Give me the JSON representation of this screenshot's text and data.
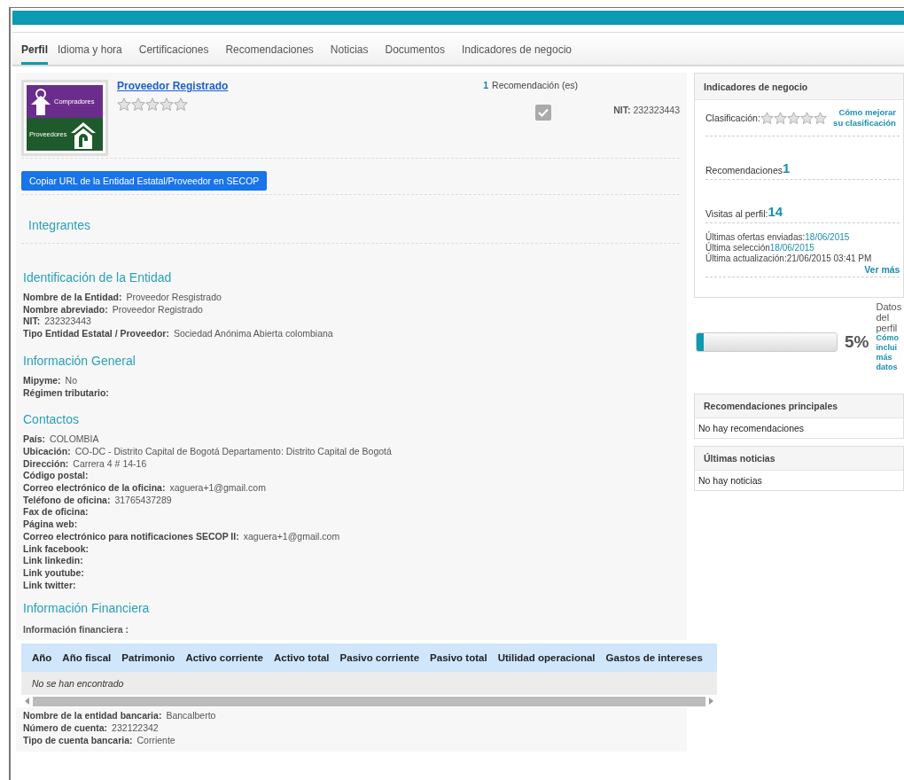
{
  "tabs": [
    {
      "label": "Perfil",
      "selected": true
    },
    {
      "label": "Idioma y hora",
      "selected": false
    },
    {
      "label": "Certificaciones",
      "selected": false
    },
    {
      "label": "Recomendaciones",
      "selected": false
    },
    {
      "label": "Noticias",
      "selected": false
    },
    {
      "label": "Documentos",
      "selected": false
    },
    {
      "label": "Indicadores de negocio",
      "selected": false
    }
  ],
  "profile": {
    "logo": {
      "top_text": "Compradores",
      "bottom_text": "Proveedores"
    },
    "name": "Proveedor Registrado",
    "stars": 0,
    "recommendations_count": "1",
    "recommendations_label": "Recomendación (es)",
    "verified": true,
    "nit_label": "NIT:",
    "nit": "232323443",
    "copy_button": "Copiar URL de la Entidad Estatal/Proveedor en SECOP",
    "members_title": "Integrantes"
  },
  "sections": [
    {
      "title": "Identificación de la Entidad",
      "fields": [
        {
          "label": "Nombre de la Entidad:",
          "value": "Proveedor Resgistrado"
        },
        {
          "label": "Nombre abreviado:",
          "value": "Proveedor Registrado"
        },
        {
          "label": "NIT:",
          "value": "232323443"
        },
        {
          "label": "Tipo Entidad Estatal / Proveedor:",
          "value": "Sociedad Anónima Abierta colombiana"
        }
      ]
    },
    {
      "title": "Información General",
      "fields": [
        {
          "label": "Mipyme:",
          "value": "No"
        },
        {
          "label": "Régimen tributario:"
        }
      ]
    },
    {
      "title": "Contactos",
      "fields": [
        {
          "label": "País:",
          "value": "COLOMBIA"
        },
        {
          "label": "Ubicación:",
          "value": "CO-DC - Distrito Capital de Bogotá Departamento: Distrito Capital de Bogotá"
        },
        {
          "label": "Dirección:",
          "value": "Carrera 4 # 14-16"
        },
        {
          "label": "Código postal:"
        },
        {
          "label": "Correo electrónico de la oficina:",
          "value": "xaguera+1@gmail.com"
        },
        {
          "label": "Teléfono de oficina:",
          "value": "31765437289"
        },
        {
          "label": "Fax de oficina:"
        },
        {
          "label": "Página web:"
        },
        {
          "label": "Correo electrónico para notificaciones SECOP II:",
          "value": "xaguera+1@gmail.com"
        },
        {
          "label": "Link facebook:"
        },
        {
          "label": "Link linkedin:"
        },
        {
          "label": "Link youtube:"
        },
        {
          "label": "Link twitter:"
        }
      ]
    }
  ],
  "financial": {
    "title": "Información Financiera",
    "caption": "Información financiera :",
    "columns": [
      "Año",
      "Año fiscal",
      "Patrimonio",
      "Activo corriente",
      "Activo total",
      "Pasivo corriente",
      "Pasivo total",
      "Utilidad operacional",
      "Gastos de intereses"
    ],
    "empty_text": "No se han encontrado",
    "bank_fields": [
      {
        "label": "Nombre de la entidad bancaria:",
        "value": "Bancalberto"
      },
      {
        "label": "Número de cuenta:",
        "value": "232122342"
      },
      {
        "label": "Tipo de cuenta bancaria:",
        "value": "Corriente"
      }
    ]
  },
  "sidebar": {
    "indicators": {
      "title": "Indicadores de negocio",
      "rating_label": "Clasificación:",
      "stars": 0,
      "improve_link": "Cómo mejorar su clasificación",
      "metrics": [
        {
          "label": "Recomendaciones",
          "value": "1"
        },
        {
          "label": "Visitas al perfil:",
          "value": "14"
        }
      ],
      "activity": [
        {
          "label": "Últimas ofertas enviadas:",
          "value": "18/06/2015",
          "kind": "link"
        },
        {
          "label": "Última selección",
          "value": "18/06/2015",
          "kind": "link"
        },
        {
          "label": "Última actualización:",
          "value": "21/06/2015 03:41 PM",
          "kind": "plain"
        }
      ],
      "more_link": "Ver más"
    },
    "progress": {
      "level": 0.05,
      "percent": "5%",
      "label": "Datos del perfil",
      "link": "Cómo inclui más datos"
    },
    "cards": [
      {
        "title": "Recomendaciones principales",
        "text": "No hay recomendaciones"
      },
      {
        "title": "Últimas noticias",
        "text": "No hay noticias"
      }
    ]
  }
}
